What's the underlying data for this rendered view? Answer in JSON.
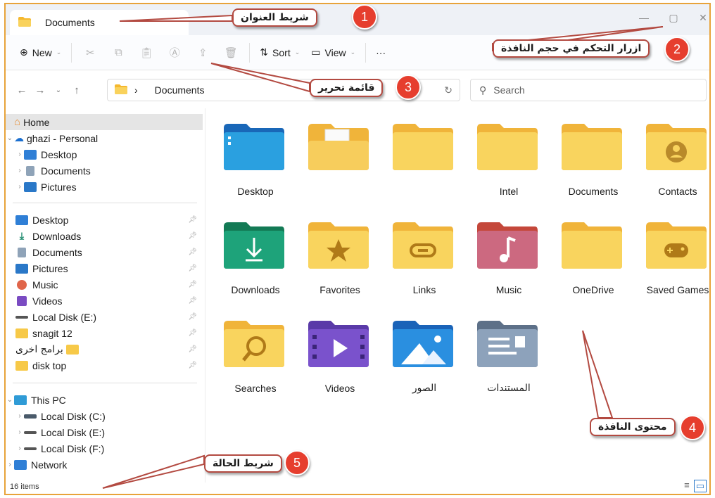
{
  "titlebar": {
    "tab_title": "Documents",
    "minimize": "—",
    "maximize": "▢",
    "close": "✕"
  },
  "toolbar": {
    "new_label": "New",
    "sort_label": "Sort",
    "view_label": "View",
    "more_label": "···"
  },
  "address": {
    "path": "Documents",
    "separator": "›",
    "search_placeholder": "Search"
  },
  "sidebar": {
    "home": "Home",
    "onedrive": "ghazi - Personal",
    "onedrive_children": [
      "Desktop",
      "Documents",
      "Pictures"
    ],
    "quick_access": [
      "Desktop",
      "Downloads",
      "Documents",
      "Pictures",
      "Music",
      "Videos",
      "Local Disk (E:)",
      "snagit 12",
      "برامج اخرى",
      "disk top"
    ],
    "this_pc": "This PC",
    "drives": [
      "Local Disk (C:)",
      "Local Disk (E:)",
      "Local Disk (F:)"
    ],
    "network": "Network"
  },
  "content": {
    "items": [
      "Desktop",
      "",
      "",
      "Intel",
      "Documents",
      "Contacts",
      "Downloads",
      "Favorites",
      "Links",
      "Music",
      "OneDrive",
      "Saved Games",
      "Searches",
      "Videos",
      "الصور",
      "المستندات"
    ]
  },
  "status": {
    "count": "16 items"
  },
  "callouts": {
    "c1": {
      "num": "1",
      "text": "شريط العنوان"
    },
    "c2": {
      "num": "2",
      "text": "ازرار التحكم في حجم النافذة"
    },
    "c3": {
      "num": "3",
      "text": "قائمة تحرير"
    },
    "c4": {
      "num": "4",
      "text": "محتوى النافذة"
    },
    "c5": {
      "num": "5",
      "text": "شريط الحالة"
    }
  },
  "colors": {
    "window_border": "#e8a33a",
    "badge": "#e63e2e",
    "callout_border": "#b34a41",
    "folder": "#f7c948"
  }
}
